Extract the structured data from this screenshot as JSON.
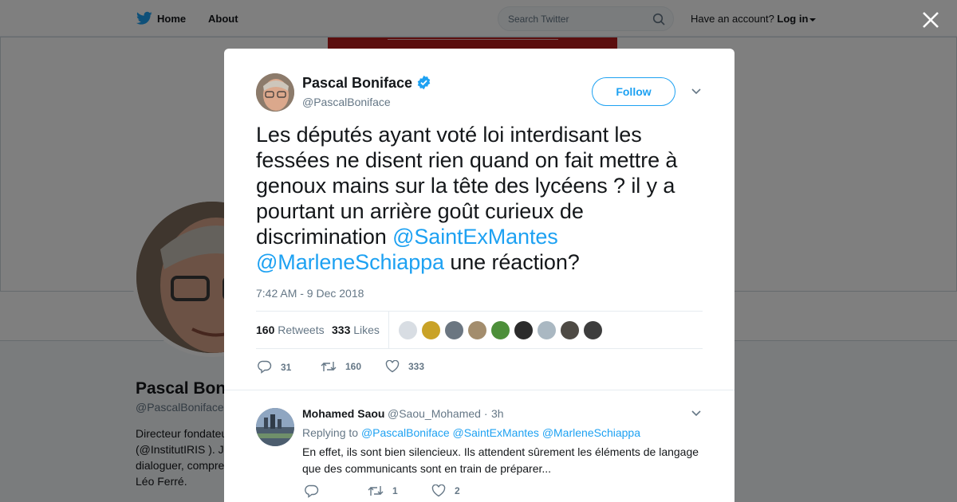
{
  "nav": {
    "home_label": "Home",
    "about_label": "About",
    "search_placeholder": "Search Twitter",
    "account_prompt": "Have an account?",
    "login_label": "Log in"
  },
  "background_profile": {
    "name": "Pascal Bon",
    "handle": "@PascalBoniface",
    "bio_lines": [
      "Directeur fondateu",
      "(@InstitutIRIS ). J",
      "dialoguer, compre",
      "Léo Ferré."
    ]
  },
  "tweet": {
    "author_name": "Pascal Boniface",
    "author_handle": "@PascalBoniface",
    "follow_label": "Follow",
    "text_before": "Les députés ayant voté loi interdisant les fessées ne disent rien quand on fait mettre à genoux mains sur la tête des lycéens ? il y a pourtant un arrière goût curieux de discrimination ",
    "mention_1": "@SaintExMantes",
    "mention_2": "@MarleneSchiappa",
    "text_after": " une réaction?",
    "timestamp": "7:42 AM - 9 Dec 2018",
    "retweets_count": "160",
    "retweets_label": "Retweets",
    "likes_count": "333",
    "likes_label": "Likes",
    "reply_action_count": "31",
    "retweet_action_count": "160",
    "like_action_count": "333"
  },
  "liker_avatar_colors": [
    "#d8dde3",
    "#c9a227",
    "#6b7681",
    "#a38d6d",
    "#4d8f3a",
    "#2b2b2b",
    "#aab8c2",
    "#4e4a44",
    "#3d3d3d"
  ],
  "reply": {
    "name": "Mohamed Saou",
    "handle": "@Saou_Mohamed",
    "separator": "·",
    "time": "3h",
    "replying_label": "Replying to",
    "replying_to": [
      "@PascalBoniface",
      "@SaintExMantes",
      "@MarleneSchiappa"
    ],
    "text": "En effet, ils sont bien silencieux. Ils attendent sûrement les éléments de langage que des communicants sont en train de préparer...",
    "retweet_count": "1",
    "like_count": "2"
  },
  "colors": {
    "accent": "#1da1f2",
    "text": "#14171a",
    "muted": "#657786",
    "banner_red": "#b71c1c"
  }
}
